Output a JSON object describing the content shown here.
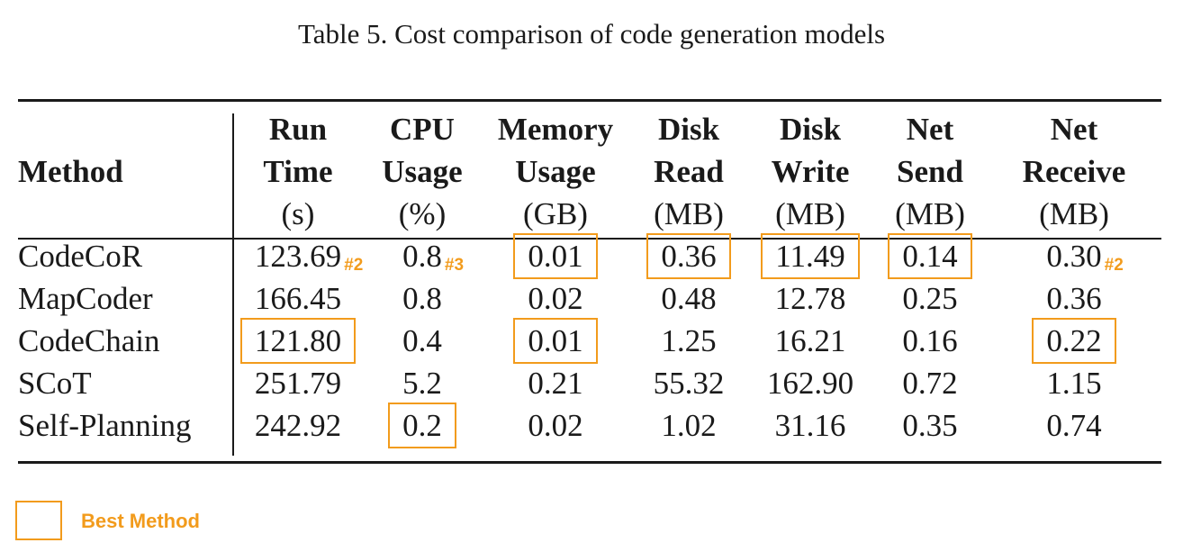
{
  "caption": "Table 5.  Cost comparison of code generation models",
  "colors": {
    "highlight": "#f29b1c",
    "text": "#1a1a1a"
  },
  "columns": [
    {
      "key": "method",
      "name": "Method",
      "unit": ""
    },
    {
      "key": "run_time",
      "name_lines": [
        "Run",
        "Time"
      ],
      "unit": "(s)"
    },
    {
      "key": "cpu",
      "name_lines": [
        "CPU",
        "Usage"
      ],
      "unit": "(%)"
    },
    {
      "key": "memory",
      "name_lines": [
        "Memory",
        "Usage"
      ],
      "unit": "(GB)"
    },
    {
      "key": "disk_read",
      "name_lines": [
        "Disk",
        "Read"
      ],
      "unit": "(MB)"
    },
    {
      "key": "disk_write",
      "name_lines": [
        "Disk",
        "Write"
      ],
      "unit": "(MB)"
    },
    {
      "key": "net_send",
      "name_lines": [
        "Net",
        "Send"
      ],
      "unit": "(MB)"
    },
    {
      "key": "net_receive",
      "name_lines": [
        "Net",
        "Receive"
      ],
      "unit": "(MB)"
    }
  ],
  "rows": [
    {
      "method": "CodeCoR",
      "values": [
        "123.69",
        "0.8",
        "0.01",
        "0.36",
        "11.49",
        "0.14",
        "0.30"
      ],
      "best": [
        false,
        false,
        true,
        true,
        true,
        true,
        false
      ],
      "rank": [
        "#2",
        "#3",
        "",
        "",
        "",
        "",
        "#2"
      ]
    },
    {
      "method": "MapCoder",
      "values": [
        "166.45",
        "0.8",
        "0.02",
        "0.48",
        "12.78",
        "0.25",
        "0.36"
      ],
      "best": [
        false,
        false,
        false,
        false,
        false,
        false,
        false
      ],
      "rank": [
        "",
        "",
        "",
        "",
        "",
        "",
        ""
      ]
    },
    {
      "method": "CodeChain",
      "values": [
        "121.80",
        "0.4",
        "0.01",
        "1.25",
        "16.21",
        "0.16",
        "0.22"
      ],
      "best": [
        true,
        false,
        true,
        false,
        false,
        false,
        true
      ],
      "rank": [
        "",
        "",
        "",
        "",
        "",
        "",
        ""
      ]
    },
    {
      "method": "SCoT",
      "values": [
        "251.79",
        "5.2",
        "0.21",
        "55.32",
        "162.90",
        "0.72",
        "1.15"
      ],
      "best": [
        false,
        false,
        false,
        false,
        false,
        false,
        false
      ],
      "rank": [
        "",
        "",
        "",
        "",
        "",
        "",
        ""
      ]
    },
    {
      "method": "Self-Planning",
      "values": [
        "242.92",
        "0.2",
        "0.02",
        "1.02",
        "31.16",
        "0.35",
        "0.74"
      ],
      "best": [
        false,
        true,
        false,
        false,
        false,
        false,
        false
      ],
      "rank": [
        "",
        "",
        "",
        "",
        "",
        "",
        ""
      ]
    }
  ],
  "legend": {
    "label": "Best Method"
  }
}
